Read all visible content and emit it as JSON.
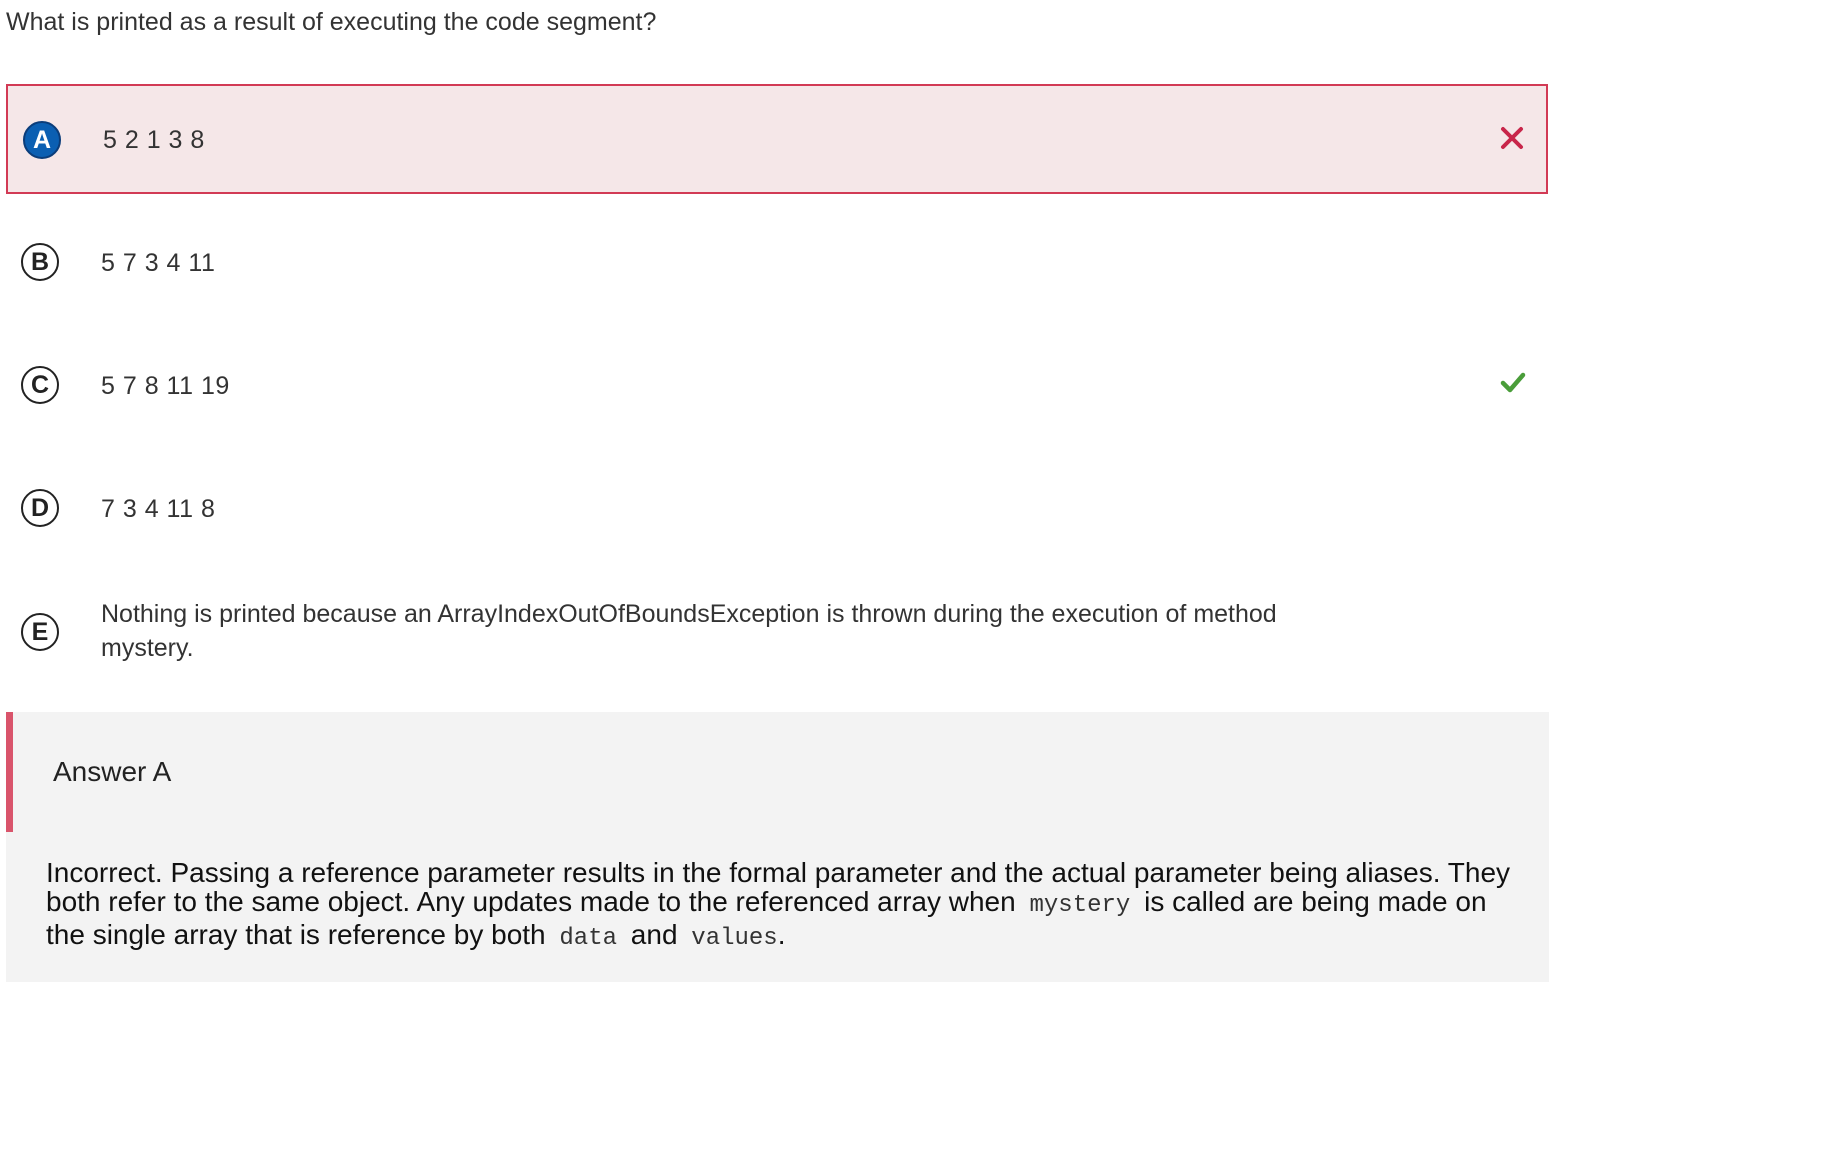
{
  "question": "What is printed as a result of executing the code segment?",
  "options": [
    {
      "letter": "A",
      "text": "5 2 1 3 8",
      "state": "selected-incorrect",
      "mark_icon": "x-mark-icon",
      "mark_color": "#c8264a"
    },
    {
      "letter": "B",
      "text": "5 7 3 4 11",
      "state": "default"
    },
    {
      "letter": "C",
      "text": "5 7 8 11 19",
      "state": "correct",
      "mark_icon": "checkmark-icon",
      "mark_color": "#4a9d3a"
    },
    {
      "letter": "D",
      "text": "7 3 4 11 8",
      "state": "default"
    },
    {
      "letter": "E",
      "text_line1": "Nothing is printed because an ArrayIndexOutOfBoundsException is thrown during the execution of method",
      "text_line2": "mystery.",
      "state": "default"
    }
  ],
  "feedback": {
    "title": "Answer A",
    "part1": "Incorrect. Passing a reference parameter results in the formal parameter and the actual parameter being aliases. They both refer to the same object. Any updates made to the referenced array when",
    "code1": "mystery",
    "part2": "is called are being made on the single array that is reference by both",
    "code2": "data",
    "part3": "and",
    "code3": "values",
    "part4": ".",
    "accent_color": "#d9546b"
  },
  "colors": {
    "selected_bg": "#f5e7e8",
    "selected_border": "#d23a55",
    "selected_letter_bg": "#0b5fb2"
  }
}
